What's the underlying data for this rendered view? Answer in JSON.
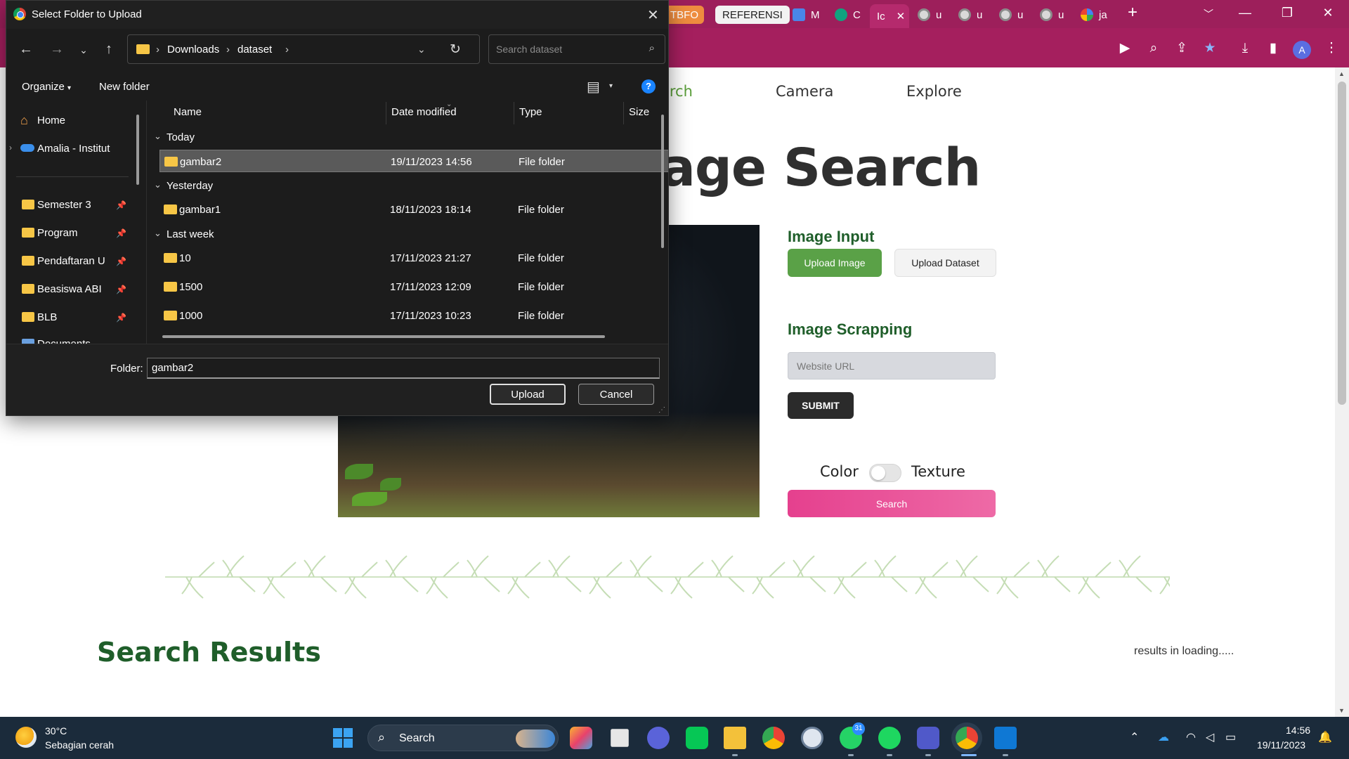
{
  "browser": {
    "tabs": [
      {
        "label": "TBFO"
      },
      {
        "label": "REFERENSI"
      },
      {
        "label": "M"
      },
      {
        "label": "C"
      },
      {
        "label": "Ic"
      },
      {
        "label": "u"
      },
      {
        "label": "u"
      },
      {
        "label": "u"
      },
      {
        "label": "u"
      },
      {
        "label": "ja"
      }
    ],
    "profile_initial": "A"
  },
  "page": {
    "nav": {
      "search": "arch",
      "camera": "Camera",
      "explore": "Explore"
    },
    "hero_title": "age Search",
    "image_input": {
      "title": "Image Input",
      "upload_image": "Upload Image",
      "upload_dataset": "Upload Dataset"
    },
    "image_scrapping": {
      "title": "Image Scrapping",
      "url_placeholder": "Website URL",
      "submit": "SUBMIT"
    },
    "toggle": {
      "left_label": "Color",
      "right_label": "Texture",
      "on": false
    },
    "search_button": "Search",
    "results": {
      "title": "Search Results",
      "status": "results in loading....."
    }
  },
  "dialog": {
    "title": "Select Folder to Upload",
    "breadcrumb": [
      "Downloads",
      "dataset"
    ],
    "search_placeholder": "Search dataset",
    "commands": {
      "organize": "Organize",
      "new_folder": "New folder",
      "help": "?"
    },
    "nav_pane": {
      "home": "Home",
      "onedrive": "Amalia - Institut",
      "pinned": [
        "Semester 3",
        "Program",
        "Pendaftaran U",
        "Beasiswa ABI",
        "BLB",
        "Documents"
      ]
    },
    "columns": {
      "name": "Name",
      "date": "Date modified",
      "type": "Type",
      "size": "Size"
    },
    "groups": [
      {
        "label": "Today",
        "files": [
          {
            "name": "gambar2",
            "date": "19/11/2023 14:56",
            "type": "File folder",
            "selected": true
          }
        ]
      },
      {
        "label": "Yesterday",
        "files": [
          {
            "name": "gambar1",
            "date": "18/11/2023 18:14",
            "type": "File folder",
            "selected": false
          }
        ]
      },
      {
        "label": "Last week",
        "files": [
          {
            "name": "10",
            "date": "17/11/2023 21:27",
            "type": "File folder",
            "selected": false
          },
          {
            "name": "1500",
            "date": "17/11/2023 12:09",
            "type": "File folder",
            "selected": false
          },
          {
            "name": "1000",
            "date": "17/11/2023 10:23",
            "type": "File folder",
            "selected": false
          }
        ]
      }
    ],
    "folder_label": "Folder:",
    "folder_value": "gambar2",
    "upload": "Upload",
    "cancel": "Cancel"
  },
  "taskbar": {
    "weather_temp": "30°C",
    "weather_desc": "Sebagian cerah",
    "search_label": "Search",
    "whatsapp_badge": "31",
    "time": "14:56",
    "date": "19/11/2023"
  },
  "colors": {
    "browser_accent": "#9d1f5b",
    "heading_green": "#1f5e2a",
    "upload_green": "#5aa147",
    "search_pink": "#e5408e"
  }
}
